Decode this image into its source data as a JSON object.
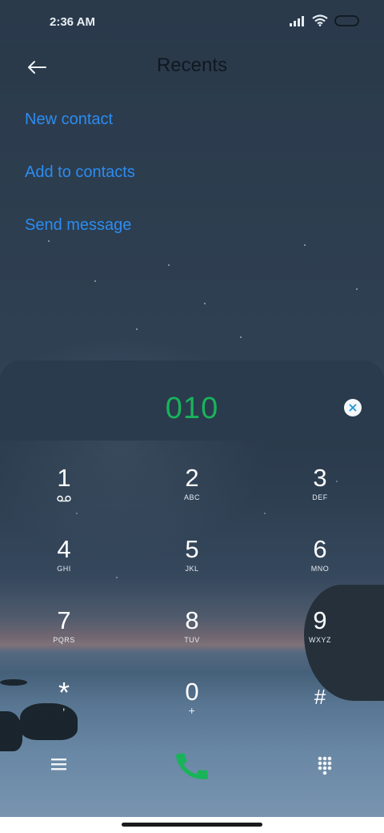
{
  "status_bar": {
    "time": "2:36 AM"
  },
  "header": {
    "title": "Recents",
    "back_icon": "back-arrow-icon"
  },
  "actions": {
    "new_contact": "New contact",
    "add_to_contacts": "Add to contacts",
    "send_message": "Send message",
    "color": "#2d8cf0"
  },
  "dialer": {
    "number": "010",
    "number_color": "#19b35a",
    "keys": [
      {
        "digit": "1",
        "letters": ""
      },
      {
        "digit": "2",
        "letters": "ABC"
      },
      {
        "digit": "3",
        "letters": "DEF"
      },
      {
        "digit": "4",
        "letters": "GHI"
      },
      {
        "digit": "5",
        "letters": "JKL"
      },
      {
        "digit": "6",
        "letters": "MNO"
      },
      {
        "digit": "7",
        "letters": "PQRS"
      },
      {
        "digit": "8",
        "letters": "TUV"
      },
      {
        "digit": "9",
        "letters": "WXYZ"
      },
      {
        "digit": "*",
        "letters": ","
      },
      {
        "digit": "0",
        "letters": "+"
      },
      {
        "digit": "#",
        "letters": ""
      }
    ]
  },
  "bottom_bar": {
    "menu_icon": "menu-icon",
    "call_icon": "phone-call-icon",
    "keypad_icon": "keypad-icon",
    "call_color": "#19b35a"
  }
}
